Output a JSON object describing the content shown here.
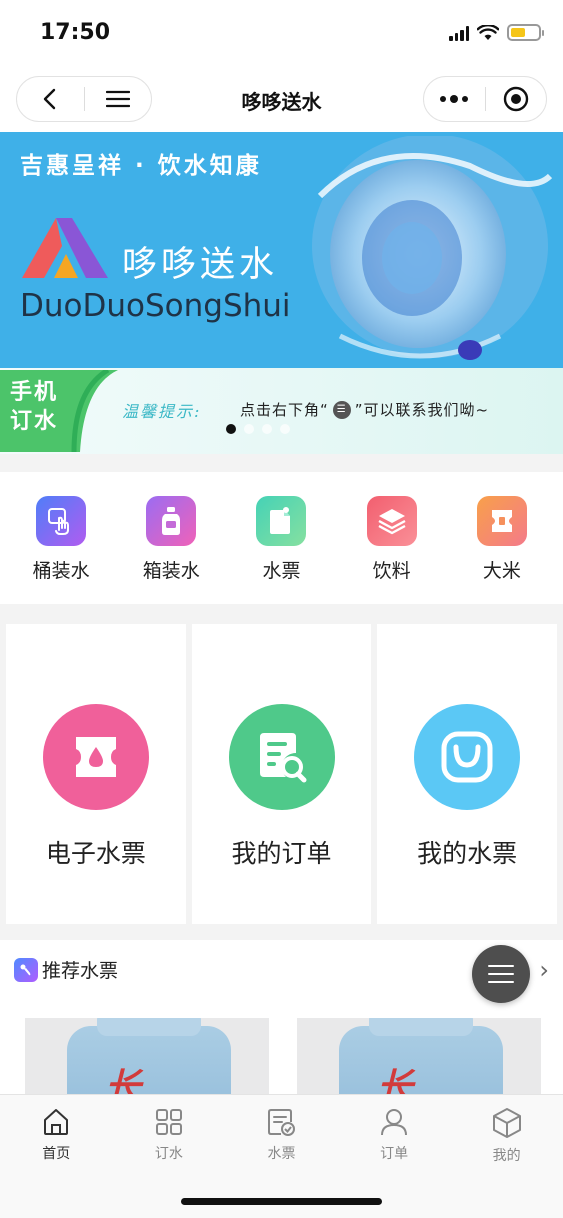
{
  "status": {
    "time": "17:50"
  },
  "nav": {
    "title": "哆哆送水"
  },
  "banner": {
    "slogan": "吉惠呈祥 · 饮水知康",
    "brand_cn": "哆哆送水",
    "brand_en": "DuoDuoSongShui"
  },
  "notice": {
    "badge_line1": "手机",
    "badge_line2": "订水",
    "label": "温馨提示:",
    "text_before": "点击右下角“",
    "text_after": "”可以联系我们呦~"
  },
  "categories": [
    {
      "label": "桶装水",
      "icon": "touch-icon",
      "color": "#7b5cf5"
    },
    {
      "label": "箱装水",
      "icon": "bottle-icon",
      "color": "#b063e8"
    },
    {
      "label": "水票",
      "icon": "ticket-icon",
      "color": "#4ecda6"
    },
    {
      "label": "饮料",
      "icon": "layers-icon",
      "color": "#f2607a"
    },
    {
      "label": "大米",
      "icon": "rice-icon",
      "color": "#f79a4c"
    }
  ],
  "cards": [
    {
      "label": "电子水票",
      "icon": "water-ticket-icon",
      "color": "#f0609a"
    },
    {
      "label": "我的订单",
      "icon": "order-search-icon",
      "color": "#4fc98a"
    },
    {
      "label": "我的水票",
      "icon": "bag-icon",
      "color": "#5bc8f5"
    }
  ],
  "recommend": {
    "title": "推荐水票",
    "items": [
      {
        "brand": "长"
      },
      {
        "brand": "长"
      }
    ]
  },
  "tabs": [
    {
      "label": "首页",
      "icon": "home-icon"
    },
    {
      "label": "订水",
      "icon": "grid-icon"
    },
    {
      "label": "水票",
      "icon": "ticket-check-icon"
    },
    {
      "label": "订单",
      "icon": "user-icon"
    },
    {
      "label": "我的",
      "icon": "cube-icon"
    }
  ]
}
